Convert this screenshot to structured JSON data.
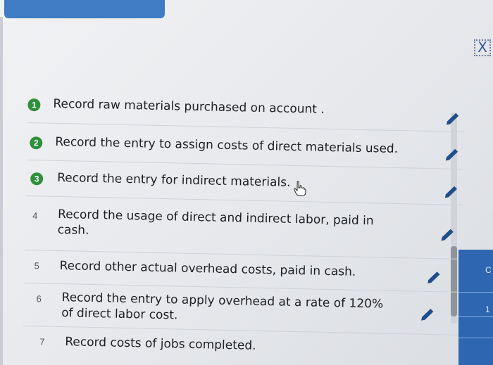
{
  "header": {
    "tab_label": ""
  },
  "close_label": "X",
  "tasks": [
    {
      "num": "1",
      "text": "Record raw materials purchased on account .",
      "completed": true
    },
    {
      "num": "2",
      "text": "Record the entry to assign costs of direct materials used.",
      "completed": true
    },
    {
      "num": "3",
      "text": "Record the entry for indirect materials.",
      "completed": true
    },
    {
      "num": "4",
      "text": "Record the usage of direct and indirect labor, paid in cash.",
      "completed": false
    },
    {
      "num": "5",
      "text": "Record other actual overhead costs, paid in cash.",
      "completed": false
    },
    {
      "num": "6",
      "text": "Record the entry to apply overhead at a rate of 120% of direct labor cost.",
      "completed": false
    },
    {
      "num": "7",
      "text": "Record costs of jobs completed.",
      "completed": false
    }
  ],
  "side_panel": {
    "frag_1": "C",
    "frag_2": "1"
  },
  "colors": {
    "accent": "#2f8f3d",
    "brand": "#2e66b2",
    "pencil": "#1f4e8c"
  },
  "icons": {
    "edit": "pencil-icon",
    "cursor": "hand-cursor-icon"
  }
}
